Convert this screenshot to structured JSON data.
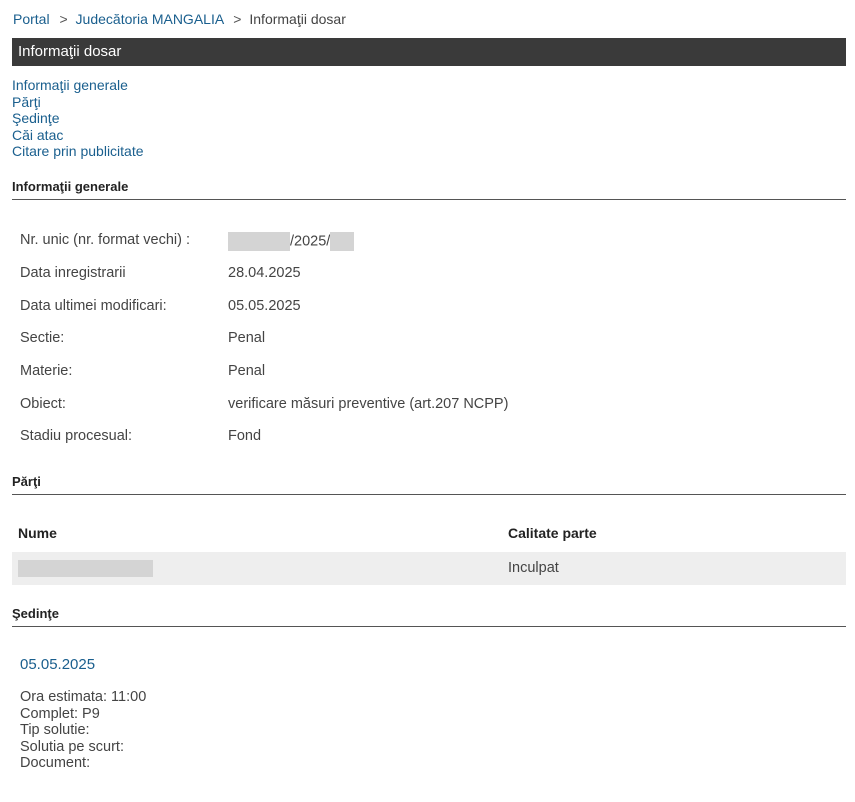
{
  "breadcrumb": {
    "portal": "Portal",
    "sep1": ">",
    "court": "Judecătoria MANGALIA",
    "sep2": ">",
    "current": "Informaţii dosar"
  },
  "title": "Informaţii dosar",
  "anchors": [
    "Informaţii generale",
    "Părţi",
    "Şedinţe",
    "Căi atac",
    "Citare prin publicitate"
  ],
  "general": {
    "heading": "Informaţii generale",
    "rows": [
      {
        "label": "Nr. unic (nr. format vechi) :",
        "value": "/2025/"
      },
      {
        "label": "Data inregistrarii",
        "value": "28.04.2025"
      },
      {
        "label": "Data ultimei modificari:",
        "value": "05.05.2025"
      },
      {
        "label": "Sectie:",
        "value": "Penal"
      },
      {
        "label": "Materie:",
        "value": "Penal"
      },
      {
        "label": "Obiect:",
        "value": "verificare măsuri preventive (art.207 NCPP)"
      },
      {
        "label": "Stadiu procesual:",
        "value": "Fond"
      }
    ]
  },
  "parti": {
    "heading": "Părţi",
    "col_name": "Nume",
    "col_role": "Calitate parte",
    "rows": [
      {
        "role": "Inculpat"
      }
    ]
  },
  "sedinte": {
    "heading": "Şedinţe",
    "date": "05.05.2025",
    "lines": [
      "Ora estimata: 11:00",
      "Complet: P9",
      "Tip solutie:",
      "Solutia pe scurt:",
      "Document:"
    ]
  }
}
